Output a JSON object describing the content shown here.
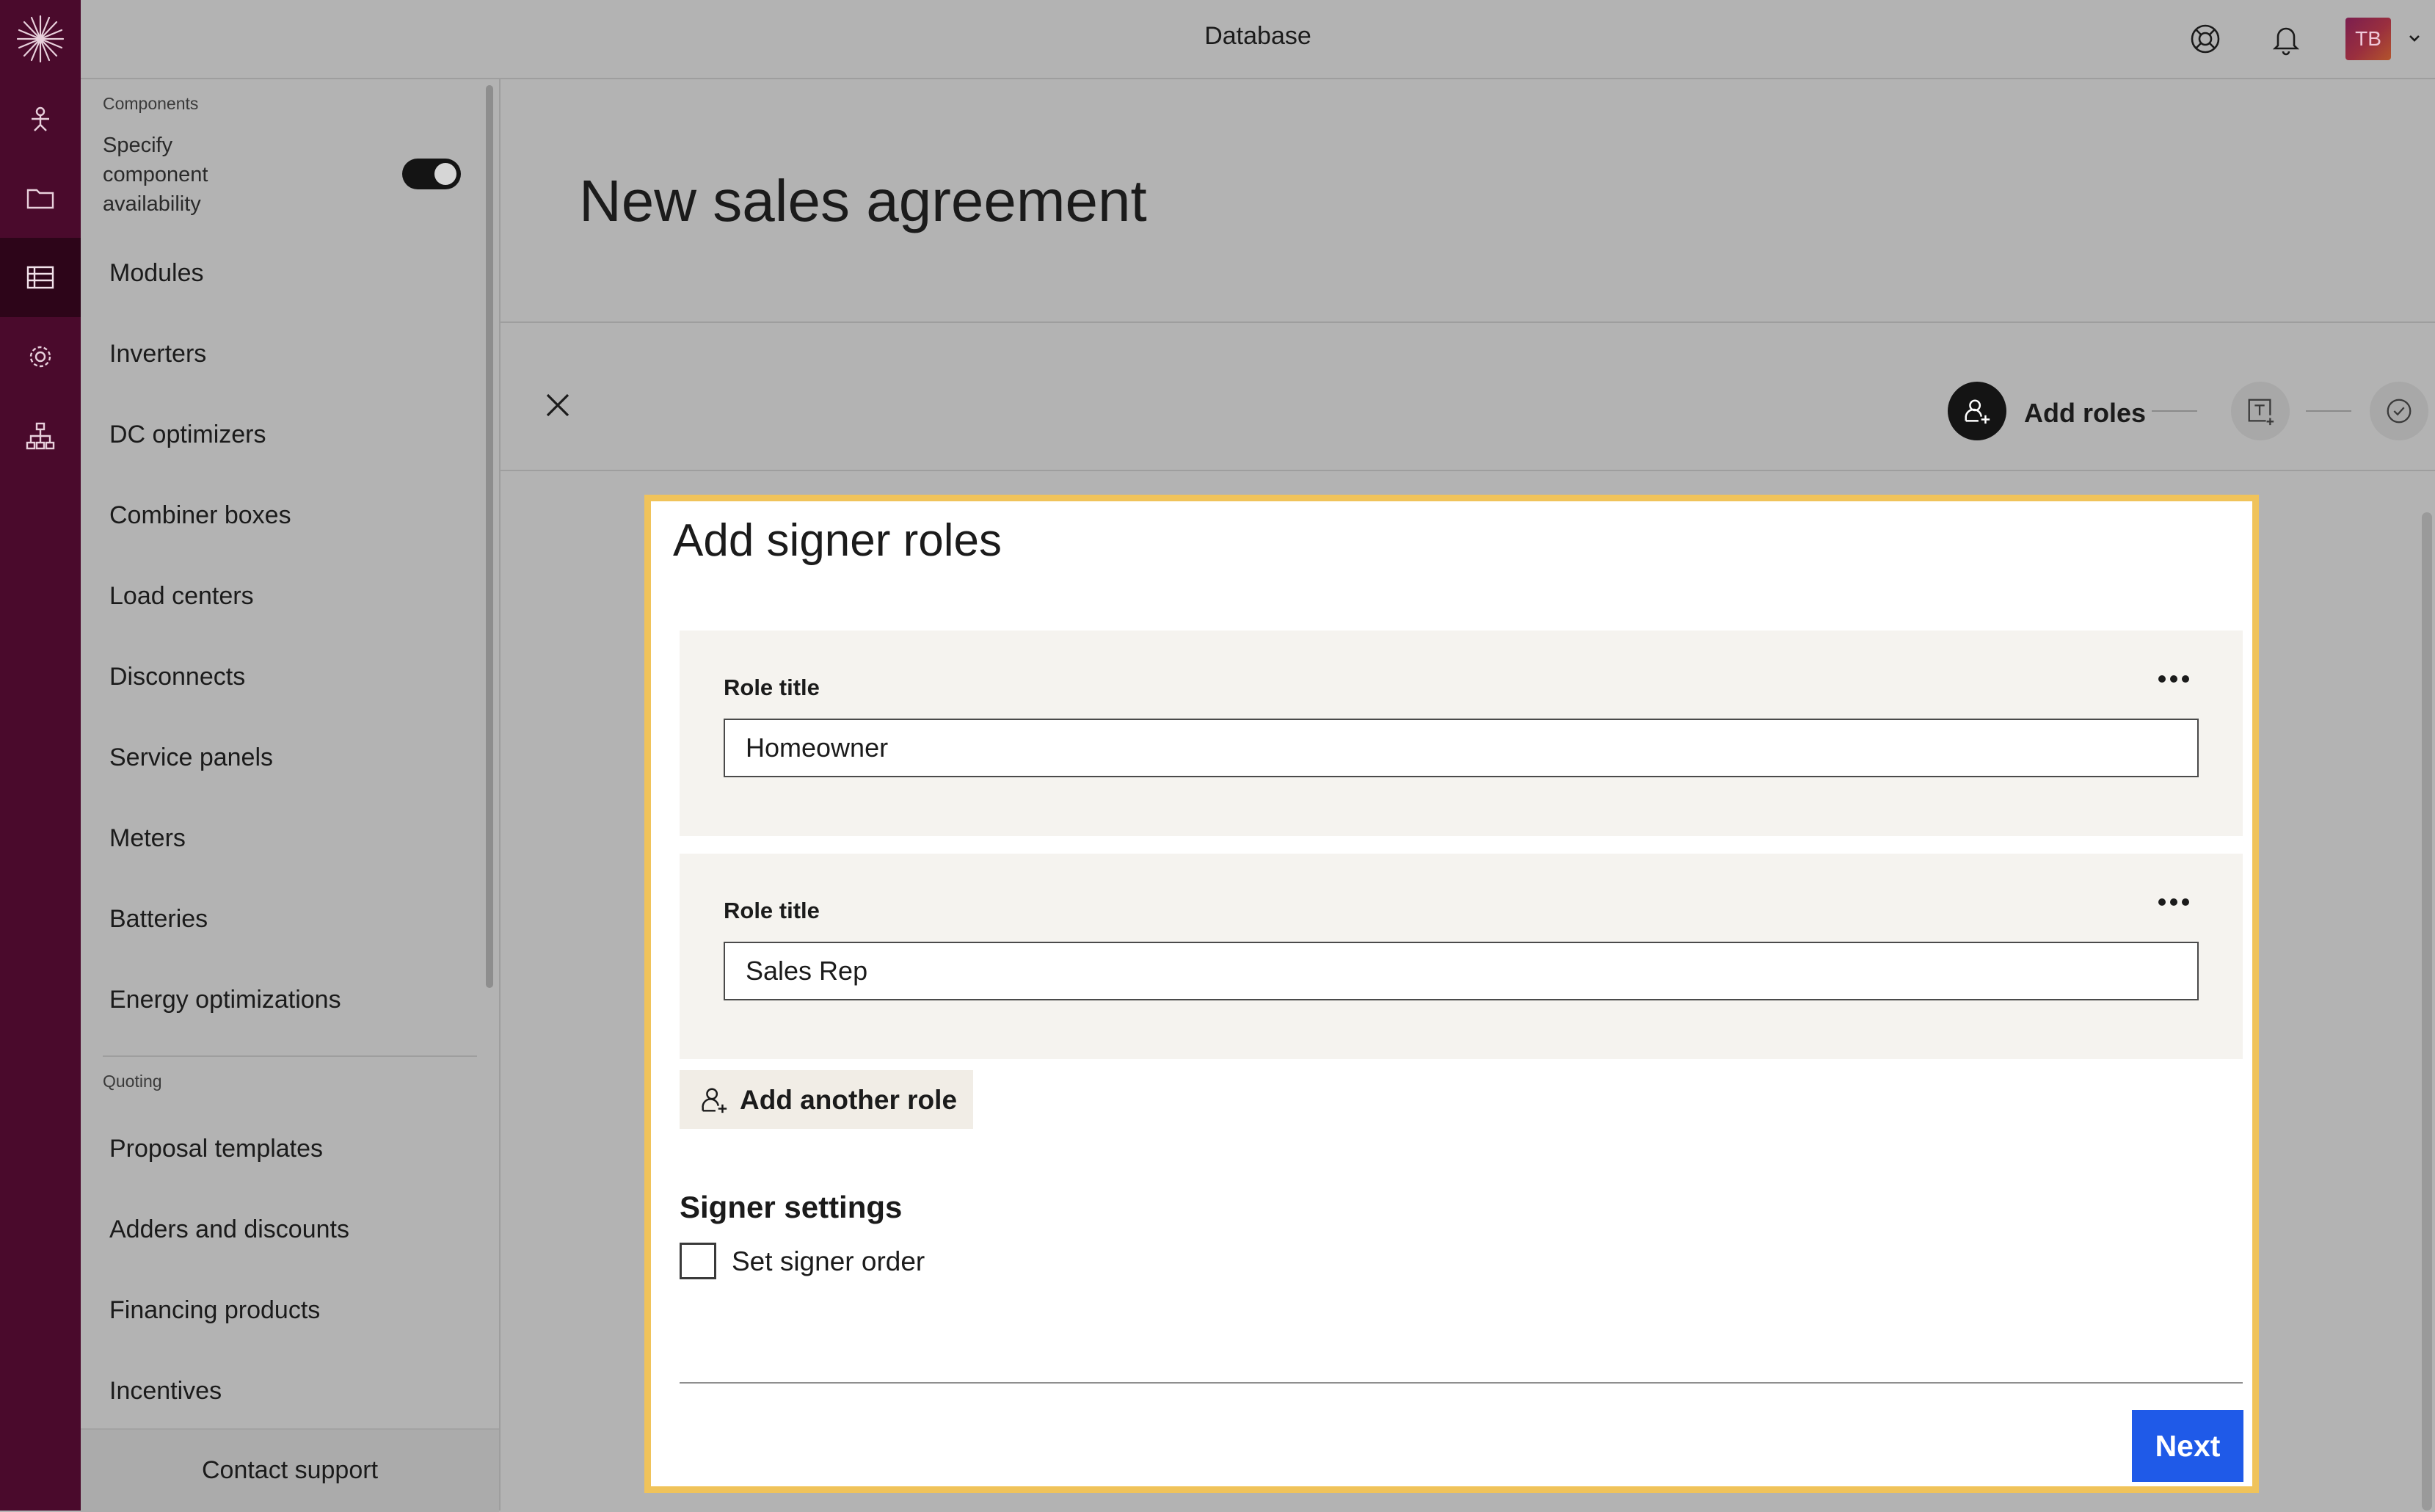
{
  "topbar": {
    "title": "Database",
    "avatar_initials": "TB"
  },
  "rail": {
    "items": [
      "logo-icon",
      "person-icon",
      "folder-icon",
      "database-icon",
      "gear-icon",
      "org-chart-icon"
    ],
    "active": "database-icon",
    "background": "#4a0a2c"
  },
  "sidebar": {
    "components_section": "Components",
    "toggle_label": "Specify component availability",
    "toggle_on": true,
    "component_items": [
      "Modules",
      "Inverters",
      "DC optimizers",
      "Combiner boxes",
      "Load centers",
      "Disconnects",
      "Service panels",
      "Meters",
      "Batteries",
      "Energy optimizations"
    ],
    "quoting_section": "Quoting",
    "quoting_items": [
      "Proposal templates",
      "Adders and discounts",
      "Financing products",
      "Incentives"
    ],
    "footer": "Contact support"
  },
  "main": {
    "page_title": "New sales agreement",
    "steps": {
      "current_label": "Add roles"
    }
  },
  "modal": {
    "title": "Add signer roles",
    "roles": [
      {
        "label": "Role title",
        "value": "Homeowner"
      },
      {
        "label": "Role title",
        "value": "Sales Rep"
      }
    ],
    "add_role_label": "Add another role",
    "signer_settings_heading": "Signer settings",
    "set_signer_order_label": "Set signer order",
    "set_signer_order_checked": false,
    "next_label": "Next",
    "accent_border": "#f0c35a",
    "next_color": "#1f5ae8"
  }
}
